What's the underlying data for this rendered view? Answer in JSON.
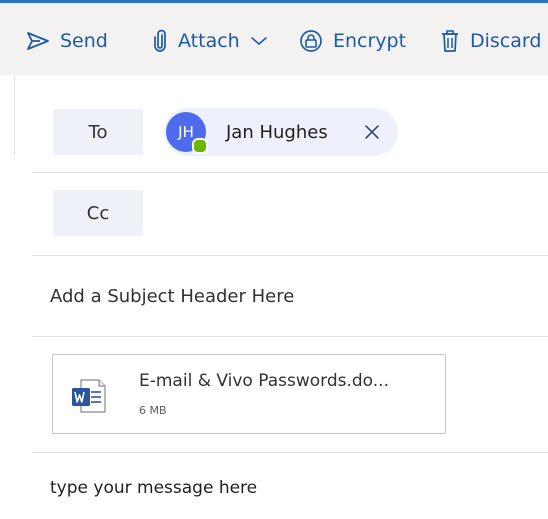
{
  "toolbar": {
    "send_label": "Send",
    "attach_label": "Attach",
    "encrypt_label": "Encrypt",
    "discard_label": "Discard",
    "icons": [
      "send-icon",
      "paperclip-icon",
      "chevron-down-icon",
      "encrypt-lock-icon",
      "trash-icon"
    ],
    "accent_color": "#1d5aa8"
  },
  "recipients": {
    "to_label": "To",
    "cc_label": "Cc",
    "to_chips": [
      {
        "initials": "JH",
        "name": "Jan Hughes",
        "avatar_color": "#4f6bed",
        "presence": "available",
        "presence_color": "#6bb700"
      }
    ]
  },
  "subject": {
    "value": "Add a Subject Header Here"
  },
  "attachment": {
    "name": "E-mail & Vivo Passwords.do...",
    "size": "6 MB",
    "icon": "word-document-icon"
  },
  "message": {
    "body": "type your message here"
  }
}
